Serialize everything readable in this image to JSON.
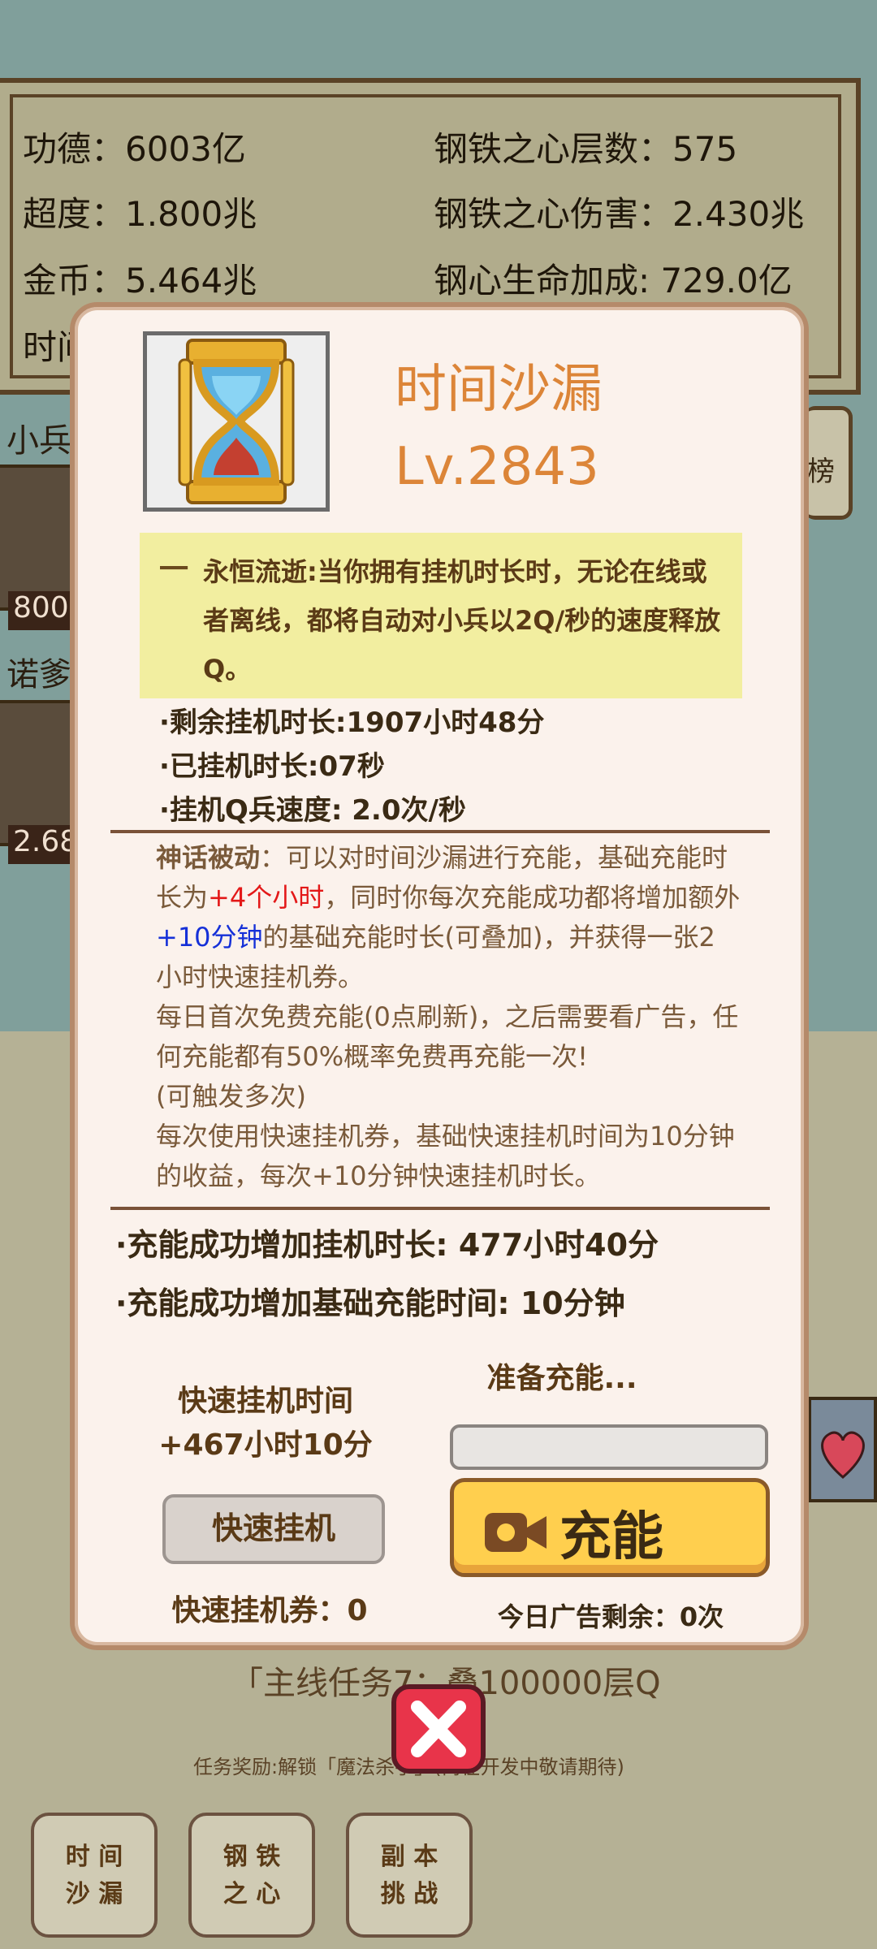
{
  "stats": {
    "merit": "功德：6003亿",
    "iron_layers": "钢铁之心层数：575",
    "transcend": "超度：1.800兆",
    "iron_damage": "钢铁之心伤害：2.430兆",
    "gold": "金币：5.464兆",
    "iron_hp": "钢心生命加成: 729.0亿",
    "time_partial": "时间"
  },
  "side": {
    "soldier_label": "小兵",
    "soldier_badge": "800",
    "noah_label": "诺爹",
    "noah_badge": "2.68",
    "rank_label": "榜"
  },
  "modal": {
    "title": "时间沙漏",
    "level": "Lv.2843",
    "desc_dash": "一",
    "desc_text": "永恒流逝:当你拥有挂机时长时，无论在线或者离线，都将自动对小兵以2Q/秒的速度释放Q。",
    "remaining": "·剩余挂机时长:1907小时48分",
    "elapsed": "·已挂机时长:07秒",
    "speed": "·挂机Q兵速度: 2.0次/秒",
    "mythic": {
      "label": "神话被动",
      "p1": "：可以对时间沙漏进行充能，基础充能时长为",
      "red": "+4个小时",
      "p2": "，同时你每次充能成功都将增加额外",
      "blue": "+10分钟",
      "p3": "的基础充能时长(可叠加)，并获得一张2小时快速挂机券。",
      "p4": "每日首次免费充能(0点刷新)，之后需要看广告，任何充能都有50%概率免费再充能一次!",
      "p5": "(可触发多次)",
      "p6": "每次使用快速挂机券，基础快速挂机时间为10分钟的收益，每次+10分钟快速挂机时长。"
    },
    "charge_add_time": "·充能成功增加挂机时长: 477小时40分",
    "charge_add_base": "·充能成功增加基础充能时间: 10分钟",
    "quick_time_label": "快速挂机时间",
    "quick_time_value": "+467小时10分",
    "quick_button": "快速挂机",
    "ticket": "快速挂机券：0",
    "ready": "准备充能...",
    "charge_progress": 0,
    "charge_button": "充能",
    "ad_left": "今日广告剩余：0次"
  },
  "task": {
    "text": "「主线任务7：叠100000层Q",
    "reward": "任务奖励:解锁「魔法杀手」(尚在开发中敬请期待)"
  },
  "tabs": [
    {
      "line1": "时 间",
      "line2": "沙 漏"
    },
    {
      "line1": "钢 铁",
      "line2": "之 心"
    },
    {
      "line1": "副 本",
      "line2": "挑 战"
    }
  ]
}
